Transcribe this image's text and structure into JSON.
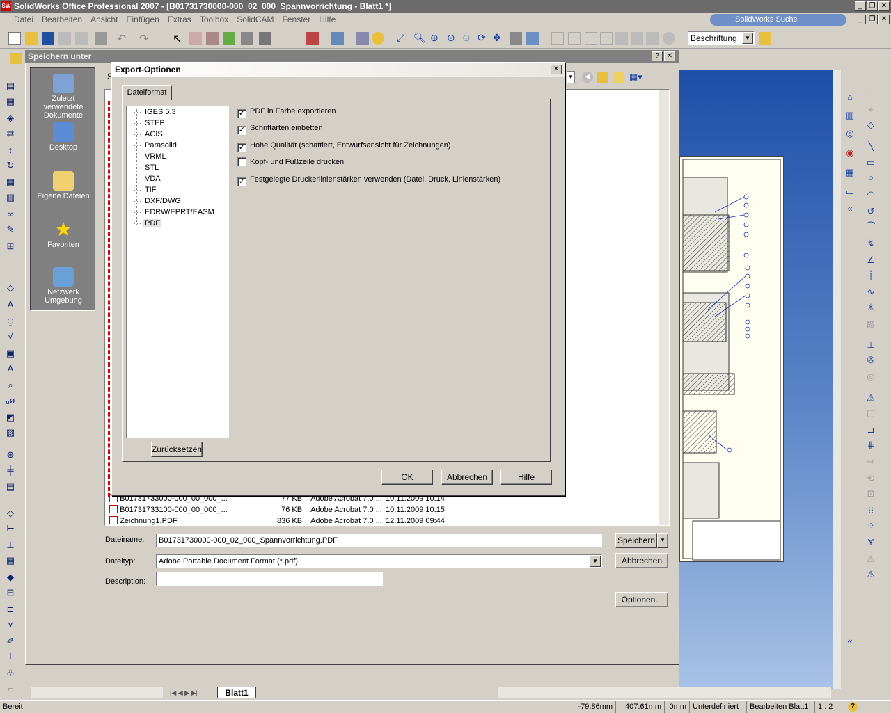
{
  "app": {
    "title": "SolidWorks Office Professional 2007 - [B01731730000-000_02_000_Spannvorrichtung - Blatt1 *]",
    "search_label": "SolidWorks Suche"
  },
  "menu": [
    "Datei",
    "Bearbeiten",
    "Ansicht",
    "Einfügen",
    "Extras",
    "Toolbox",
    "SolidCAM",
    "Fenster",
    "Hilfe"
  ],
  "toolbar": {
    "combo_value": "Beschriftung"
  },
  "saveas": {
    "title": "Speichern unter",
    "places": [
      {
        "label": "Zuletzt verwendete Dokumente"
      },
      {
        "label": "Desktop"
      },
      {
        "label": "Eigene Dateien"
      },
      {
        "label": "Favoriten"
      },
      {
        "label": "Netzwerk Umgebung"
      }
    ],
    "files": [
      {
        "name": "B01731733000-000_00_000_...",
        "size": "77 KB",
        "type": "Adobe Acrobat 7.0 ...",
        "date": "10.11.2009 10:14"
      },
      {
        "name": "B01731733100-000_00_000_...",
        "size": "76 KB",
        "type": "Adobe Acrobat 7.0 ...",
        "date": "10.11.2009 10:15"
      },
      {
        "name": "Zeichnung1.PDF",
        "size": "836 KB",
        "type": "Adobe Acrobat 7.0 ...",
        "date": "12.11.2009 09:44"
      }
    ],
    "filename_label": "Dateiname:",
    "filename_value": "B01731730000-000_02_000_Spannvorrichtung.PDF",
    "filetype_label": "Dateityp:",
    "filetype_value": "Adobe Portable Document Format (*.pdf)",
    "description_label": "Description:",
    "save_btn": "Speichern",
    "cancel_btn": "Abbrechen",
    "options_btn": "Optionen..."
  },
  "export": {
    "title": "Export-Optionen",
    "tab": "Dateiformat",
    "formats": [
      "IGES 5.3",
      "STEP",
      "ACIS",
      "Parasolid",
      "VRML",
      "STL",
      "VDA",
      "TIF",
      "DXF/DWG",
      "EDRW/EPRT/EASM",
      "PDF"
    ],
    "selected_format": "PDF",
    "options": [
      {
        "label": "PDF in Farbe exportieren",
        "checked": true
      },
      {
        "label": "Schriftarten einbetten",
        "checked": true
      },
      {
        "label": "Hohe Qualität (schattiert, Entwurfsansicht für Zeichnungen)",
        "checked": true
      },
      {
        "label": "Kopf- und Fußzeile drucken",
        "checked": false
      },
      {
        "label": "Festgelegte Druckerlinienstärken verwenden (Datei, Druck, Linienstärken)",
        "checked": true
      }
    ],
    "reset_btn": "Zurücksetzen",
    "ok_btn": "OK",
    "cancel_btn": "Abbrechen",
    "help_btn": "Hilfe"
  },
  "sheet_tab": "Blatt1",
  "status": {
    "left": "Bereit",
    "x": "-79.86mm",
    "y": "407.61mm",
    "z": "0mm",
    "state": "Unterdefiniert",
    "mode": "Bearbeiten Blatt1",
    "scale": "1 : 2"
  }
}
